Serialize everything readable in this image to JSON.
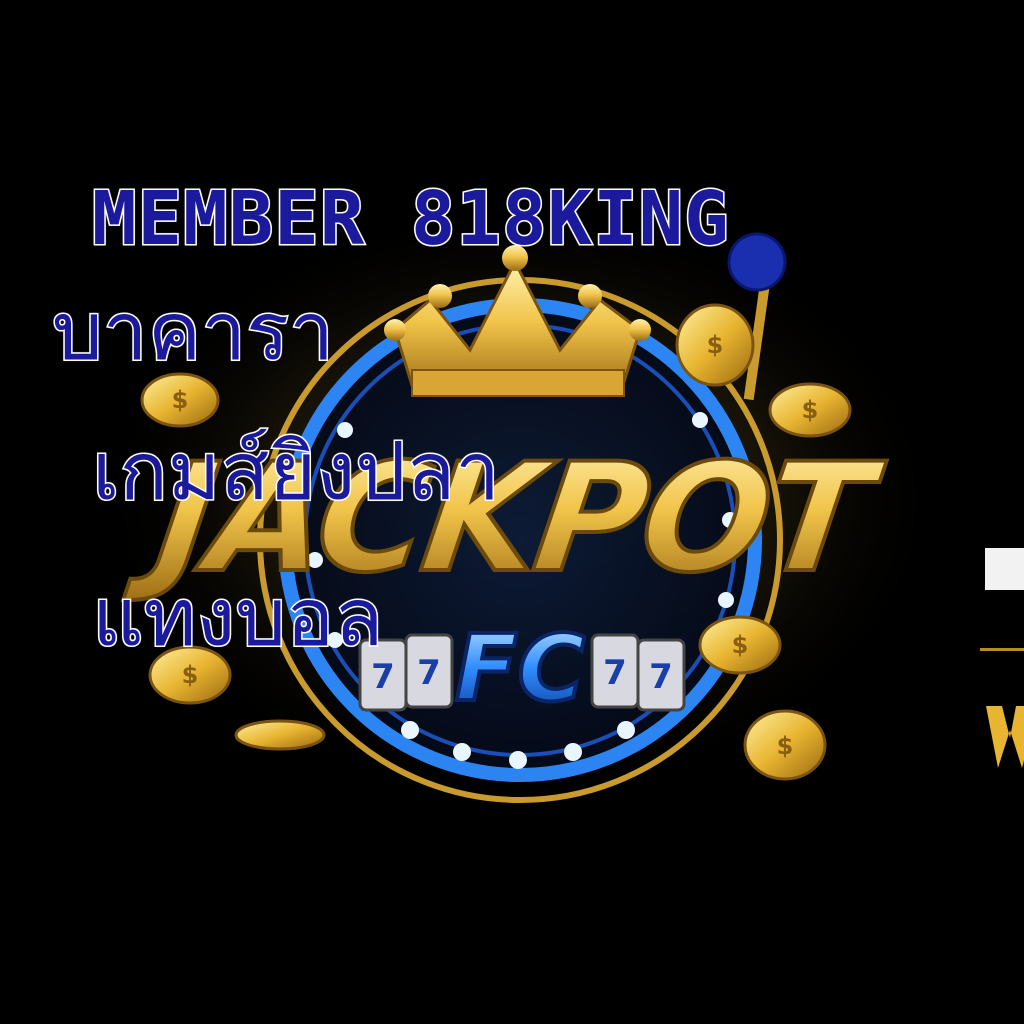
{
  "overlay": {
    "member": "MEMBER 818KING",
    "baccarat": "บาคารา",
    "fishing": "เกมส์ยิงปลา",
    "football": "แทงบอล"
  },
  "logo": {
    "jackpot": "JACKPOT",
    "fc": "FC"
  },
  "colors": {
    "background": "#000000",
    "overlay_text": "#1c1a9c",
    "outline": "#ffffff",
    "gold": "#e8b531",
    "ring_blue": "#2e8cff"
  }
}
